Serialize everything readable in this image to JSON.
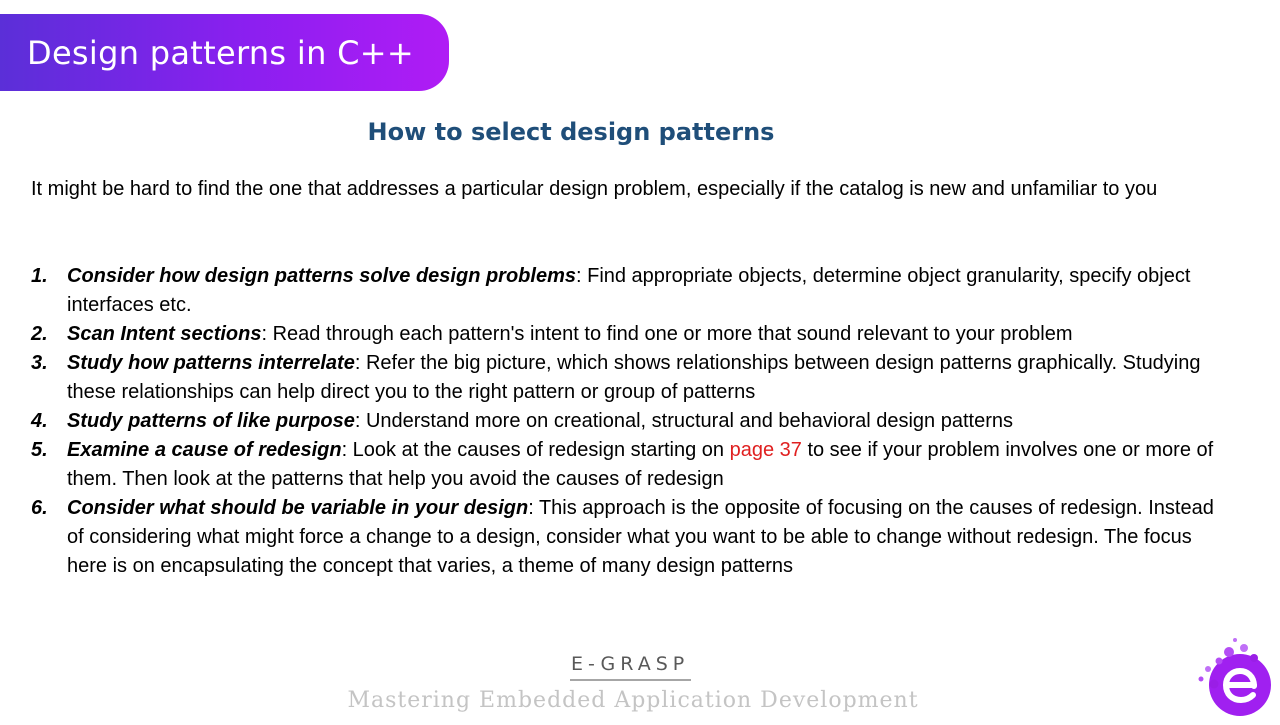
{
  "header": {
    "title": "Design patterns in C++",
    "accent_colors": [
      "#5b2fd8",
      "#b01cf5"
    ]
  },
  "slide": {
    "subtitle": "How to select design patterns",
    "intro": "It might be hard to find the one that addresses a particular design problem, especially if the catalog is new and unfamiliar to you",
    "steps": [
      {
        "number": "1.",
        "lead": "Consider how design patterns solve design problems",
        "text": ": Find appropriate objects, determine object granularity, specify object interfaces etc."
      },
      {
        "number": "2.",
        "lead": "Scan Intent sections",
        "text": ": Read through each pattern's intent to find one or more that sound relevant to your problem"
      },
      {
        "number": "3.",
        "lead": "Study how patterns interrelate",
        "text": ": Refer the big picture, which shows relationships between design patterns graphically. Studying these relationships can help direct you to the right pattern or group of patterns"
      },
      {
        "number": "4.",
        "lead": "Study patterns of like purpose",
        "text": ": Understand more on creational, structural and behavioral design patterns"
      },
      {
        "number": "5.",
        "lead": "Examine a cause of redesign",
        "text_before": ": Look at the causes of redesign starting on ",
        "link": "page 37",
        "text_after": " to see if your problem involves one or more of them. Then look at the patterns that help you avoid the causes of redesign"
      },
      {
        "number": "6.",
        "lead": "Consider what should be variable in your design",
        "text": ": This approach is the opposite of focusing on the causes of redesign. Instead of considering what might force a change to a design, consider what you want to be able to change without redesign. The focus here is on encapsulating the concept that varies, a theme of many design patterns"
      }
    ]
  },
  "footer": {
    "brand": "E-GRASP",
    "tagline": "Mastering Embedded Application Development",
    "logo_icon": "e-grasp-logo-icon",
    "logo_color": "#a020f0"
  }
}
